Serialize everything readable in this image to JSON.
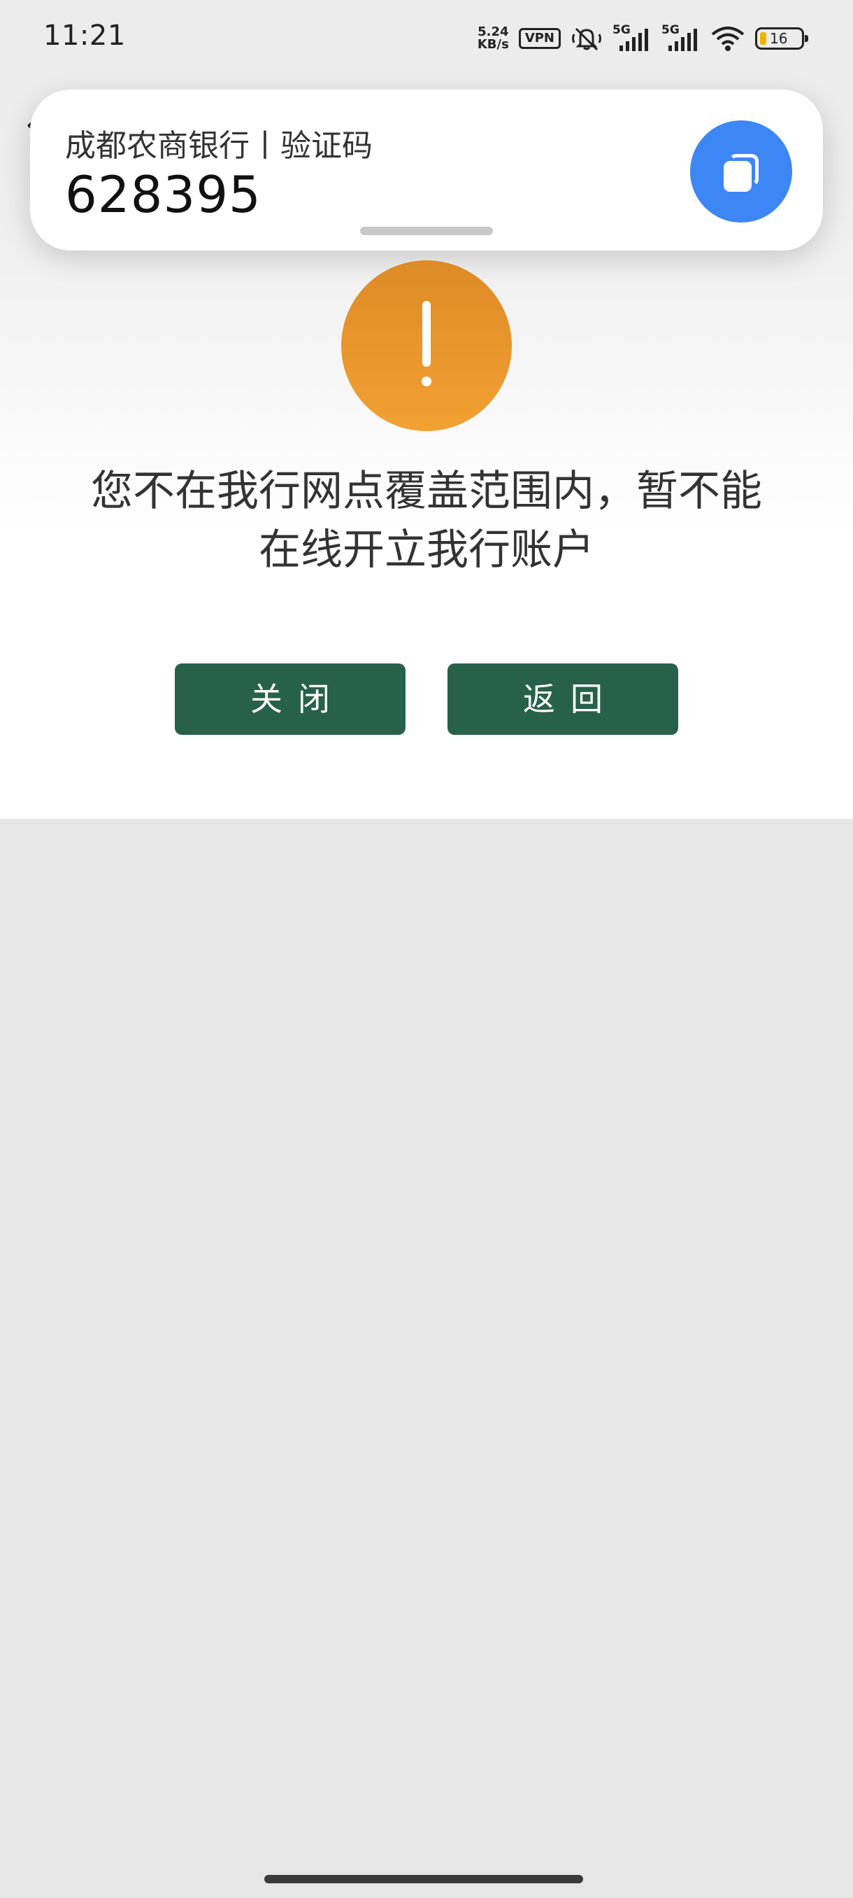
{
  "status_bar": {
    "time": "11:21",
    "net_speed_value": "5.24",
    "net_speed_unit": "KB/s",
    "vpn": "VPN",
    "signal_1_label": "5G",
    "signal_2_label": "5G",
    "battery_level": "16",
    "icons": [
      "mute-icon",
      "signal-icon",
      "wifi-icon",
      "battery-icon"
    ]
  },
  "notification": {
    "title": "成都农商银行丨验证码",
    "code": "628395",
    "copy_icon": "copy-icon",
    "accent_color": "#3d86f5"
  },
  "dialog": {
    "icon": "warning-icon",
    "icon_color": "#f0a030",
    "message_line1": "您不在我行网点覆盖范围内，暂不能",
    "message_line2": "在线开立我行账户",
    "close_label": "关闭",
    "return_label": "返回",
    "button_color": "#27614a"
  }
}
